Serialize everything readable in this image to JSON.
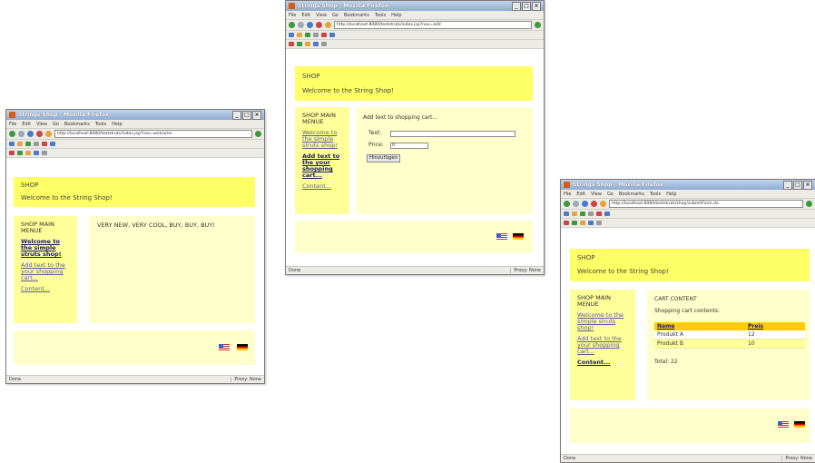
{
  "windows": [
    {
      "id": "welcome",
      "title": "Strings Shop - Mozilla Firefox",
      "menu": [
        "File",
        "Edit",
        "View",
        "Go",
        "Bookmarks",
        "Tools",
        "Help"
      ],
      "url": "http://localhost:8080/teststruts/index.jsp?nav=welcome",
      "status_left": "Done",
      "status_right": "Proxy: None",
      "header_title": "SHOP",
      "header_subtitle": "Welcome to the String Shop!",
      "menu_title": "SHOP MAIN MENUE",
      "links": [
        {
          "label": "Welcome to the simple struts shop!",
          "active": true
        },
        {
          "label": "Add text to the your shopping cart...",
          "active": false
        },
        {
          "label": "Content...",
          "active": false
        }
      ],
      "main_text": "VERY NEW, VERY COOL, BUY, BUY, BUY!"
    },
    {
      "id": "add",
      "title": "Strings Shop - Mozilla Firefox",
      "menu": [
        "File",
        "Edit",
        "View",
        "Go",
        "Bookmarks",
        "Tools",
        "Help"
      ],
      "url": "http://localhost:8080/teststruts/index.jsp?nav=add",
      "status_left": "Done",
      "status_right": "Proxy: None",
      "header_title": "SHOP",
      "header_subtitle": "Welcome to the String Shop!",
      "menu_title": "SHOP MAIN MENUE",
      "links": [
        {
          "label": "Welcome to the simple struts shop!",
          "active": false
        },
        {
          "label": "Add text to the your shopping cart...",
          "active": true
        },
        {
          "label": "Content...",
          "active": false
        }
      ],
      "form": {
        "heading": "Add text to shopping cart...",
        "text_label": "Text:",
        "text_value": "",
        "price_label": "Price:",
        "price_value": "0",
        "submit_label": "Hinzufügen"
      }
    },
    {
      "id": "cart",
      "title": "Strings Shop - Mozilla Firefox",
      "menu": [
        "File",
        "Edit",
        "View",
        "Go",
        "Bookmarks",
        "Tools",
        "Help"
      ],
      "url": "http://localhost:8080/teststruts/shop/submitForm.do",
      "status_left": "Done",
      "status_right": "Proxy: None",
      "header_title": "SHOP",
      "header_subtitle": "Welcome to the String Shop!",
      "menu_title": "SHOP MAIN MENUE",
      "links": [
        {
          "label": "Welcome to the simple struts shop!",
          "active": false
        },
        {
          "label": "Add text to the your shopping cart...",
          "active": false
        },
        {
          "label": "Content...",
          "active": true
        }
      ],
      "cart": {
        "heading": "CART CONTENT",
        "subheading": "Shopping cart contents:",
        "columns": [
          "Name",
          "Preis"
        ],
        "rows": [
          [
            "Produkt A",
            "12"
          ],
          [
            "Produkt B",
            "10"
          ]
        ],
        "total": "Total: 22"
      }
    }
  ]
}
